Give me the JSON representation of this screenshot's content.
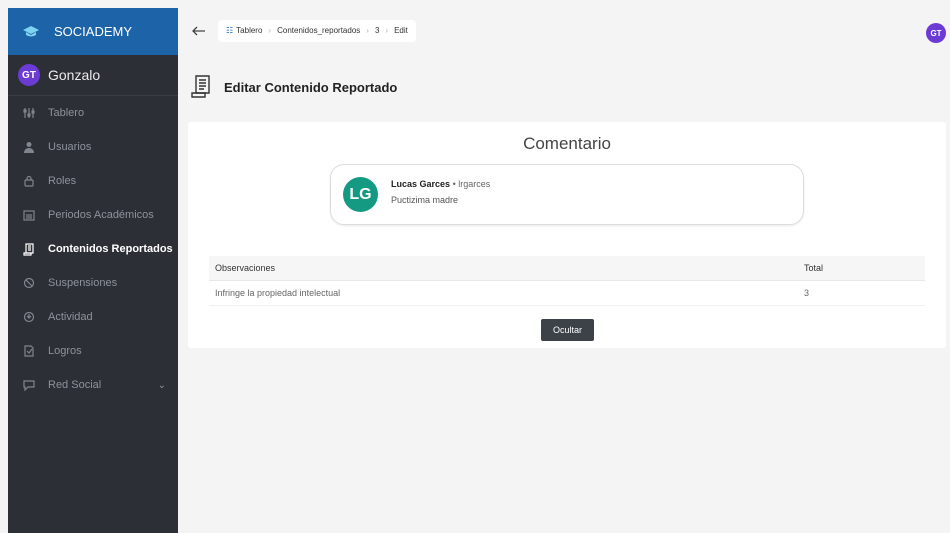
{
  "app": {
    "brand": "SOCIADEMY"
  },
  "user": {
    "initials": "GT",
    "name": "Gonzalo"
  },
  "sidebar": {
    "items": [
      {
        "label": "Tablero",
        "icon": "dashboard-icon"
      },
      {
        "label": "Usuarios",
        "icon": "user-icon"
      },
      {
        "label": "Roles",
        "icon": "lock-icon"
      },
      {
        "label": "Periodos Académicos",
        "icon": "calendar-icon"
      },
      {
        "label": "Contenidos Reportados",
        "icon": "report-icon",
        "active": true
      },
      {
        "label": "Suspensiones",
        "icon": "ban-icon"
      },
      {
        "label": "Actividad",
        "icon": "activity-icon"
      },
      {
        "label": "Logros",
        "icon": "badge-icon"
      },
      {
        "label": "Red Social",
        "icon": "network-icon",
        "expandable": true
      }
    ]
  },
  "breadcrumb": {
    "items": [
      "Tablero",
      "Contenidos_reportados",
      "3",
      "Edit"
    ]
  },
  "header": {
    "avatar_initials": "GT"
  },
  "page": {
    "title": "Editar Contenido Reportado"
  },
  "card": {
    "title": "Comentario",
    "comment": {
      "avatar_initials": "LG",
      "author": "Lucas Garces",
      "separator": "•",
      "handle": "lrgarces",
      "text": "Puctizima madre"
    },
    "table": {
      "headers": [
        "Observaciones",
        "Total"
      ],
      "rows": [
        {
          "observacion": "Infringe la propiedad intelectual",
          "total": "3"
        }
      ]
    },
    "button": "Ocultar"
  },
  "colors": {
    "brand": "#1d63a8",
    "sidebar": "#2c2f35",
    "avatar": "#6c3bd6",
    "comment_avatar": "#149a83"
  }
}
